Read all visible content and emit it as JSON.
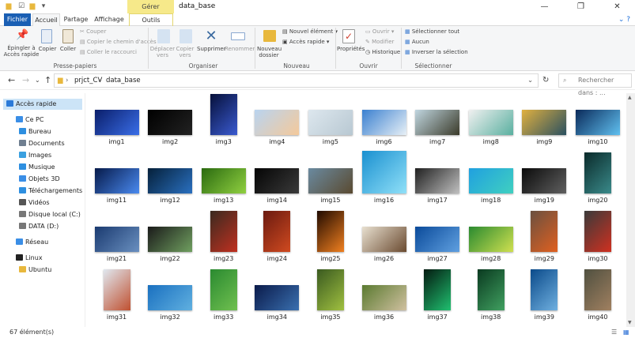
{
  "window": {
    "title": "data_base",
    "context_tab": "Gérer"
  },
  "tabs": [
    "Fichier",
    "Accueil",
    "Partage",
    "Affichage",
    "Outils d'image"
  ],
  "ribbon": {
    "presse_papiers": {
      "label": "Presse-papiers",
      "pin": "Épingler à\nAccès rapide",
      "copy": "Copier",
      "paste": "Coller",
      "cut": "Couper",
      "copy_path": "Copier le chemin d'accès",
      "paste_shortcut": "Coller le raccourci"
    },
    "organiser": {
      "label": "Organiser",
      "move": "Déplacer\nvers",
      "copy_to": "Copier\nvers",
      "delete": "Supprimer",
      "rename": "Renommer"
    },
    "nouveau": {
      "label": "Nouveau",
      "new_folder": "Nouveau\ndossier",
      "new_item": "Nouvel élément",
      "easy_access": "Accès rapide"
    },
    "ouvrir": {
      "label": "Ouvrir",
      "properties": "Propriétés",
      "open": "Ouvrir",
      "edit": "Modifier",
      "history": "Historique"
    },
    "selectionner": {
      "label": "Sélectionner",
      "select_all": "Sélectionner tout",
      "select_none": "Aucun",
      "invert": "Inverser la sélection"
    }
  },
  "address": {
    "parts": [
      "prjct_CV",
      "data_base"
    ],
    "search_placeholder": "Rechercher dans : ..."
  },
  "sidebar": [
    {
      "label": "Accès rapide",
      "icon": "star-icon",
      "color": "#2b7ad8",
      "selected": true
    },
    {
      "label": "Ce PC",
      "icon": "computer-icon",
      "color": "#3a8ee6"
    },
    {
      "label": "Bureau",
      "icon": "desktop-icon",
      "color": "#2e8fe0"
    },
    {
      "label": "Documents",
      "icon": "documents-icon",
      "color": "#6f7f90"
    },
    {
      "label": "Images",
      "icon": "images-icon",
      "color": "#3aa0e0"
    },
    {
      "label": "Musique",
      "icon": "music-icon",
      "color": "#2e8fe0"
    },
    {
      "label": "Objets 3D",
      "icon": "cube-icon",
      "color": "#3a8ee6"
    },
    {
      "label": "Téléchargements",
      "icon": "download-icon",
      "color": "#2e8fe0"
    },
    {
      "label": "Vidéos",
      "icon": "video-icon",
      "color": "#555"
    },
    {
      "label": "Disque local (C:)",
      "icon": "drive-icon",
      "color": "#777"
    },
    {
      "label": "DATA (D:)",
      "icon": "drive-icon",
      "color": "#777"
    },
    {
      "label": "Réseau",
      "icon": "network-icon",
      "color": "#3a8ee6"
    },
    {
      "label": "Linux",
      "icon": "linux-icon",
      "color": "#222"
    },
    {
      "label": "Ubuntu",
      "icon": "folder-icon",
      "color": "#e8b83d"
    }
  ],
  "files": [
    {
      "name": "img1",
      "c1": "#0a1e6a",
      "c2": "#3a6ee8",
      "o": "l"
    },
    {
      "name": "img2",
      "c1": "#000",
      "c2": "#222",
      "o": "l"
    },
    {
      "name": "img3",
      "c1": "#06103a",
      "c2": "#3a5ad0",
      "o": "p"
    },
    {
      "name": "img4",
      "c1": "#b9d4f0",
      "c2": "#f4c99a",
      "o": "l"
    },
    {
      "name": "img5",
      "c1": "#dde7ee",
      "c2": "#b8c8d2",
      "o": "l"
    },
    {
      "name": "img6",
      "c1": "#3a80d0",
      "c2": "#e8f0f6",
      "o": "l"
    },
    {
      "name": "img7",
      "c1": "#c0d6e0",
      "c2": "#3b3b2a",
      "o": "l"
    },
    {
      "name": "img8",
      "c1": "#f0f0f0",
      "c2": "#5ab0a0",
      "o": "l"
    },
    {
      "name": "img9",
      "c1": "#e0b040",
      "c2": "#2a5060",
      "o": "l"
    },
    {
      "name": "img10",
      "c1": "#0a2a5a",
      "c2": "#60c0f0",
      "o": "l"
    },
    {
      "name": "img11",
      "c1": "#061a4a",
      "c2": "#4a8af0",
      "o": "l"
    },
    {
      "name": "img12",
      "c1": "#05203a",
      "c2": "#2a70c0",
      "o": "l"
    },
    {
      "name": "img13",
      "c1": "#2a6a10",
      "c2": "#90d040",
      "o": "l"
    },
    {
      "name": "img14",
      "c1": "#050505",
      "c2": "#3a3a3a",
      "o": "l"
    },
    {
      "name": "img15",
      "c1": "#6a8aa0",
      "c2": "#5a4a30",
      "o": "l"
    },
    {
      "name": "img16",
      "c1": "#1a90d0",
      "c2": "#90e0f8",
      "o": "s"
    },
    {
      "name": "img17",
      "c1": "#202020",
      "c2": "#c0c0c0",
      "o": "l"
    },
    {
      "name": "img18",
      "c1": "#20a0e0",
      "c2": "#40d0c0",
      "o": "l"
    },
    {
      "name": "img19",
      "c1": "#0a0a0a",
      "c2": "#606060",
      "o": "l"
    },
    {
      "name": "img20",
      "c1": "#0a2a2a",
      "c2": "#3a8a8a",
      "o": "p"
    },
    {
      "name": "img21",
      "c1": "#1a3a70",
      "c2": "#6a90c0",
      "o": "l"
    },
    {
      "name": "img22",
      "c1": "#1a1a1a",
      "c2": "#70a060",
      "o": "l"
    },
    {
      "name": "img23",
      "c1": "#3a2a20",
      "c2": "#c03020",
      "o": "p"
    },
    {
      "name": "img24",
      "c1": "#6a1a10",
      "c2": "#d04a20",
      "o": "p"
    },
    {
      "name": "img25",
      "c1": "#200a00",
      "c2": "#f08020",
      "o": "p"
    },
    {
      "name": "img26",
      "c1": "#e8e0d0",
      "c2": "#6a4a30",
      "o": "l"
    },
    {
      "name": "img27",
      "c1": "#0a4a9a",
      "c2": "#60a0e0",
      "o": "l"
    },
    {
      "name": "img28",
      "c1": "#2a8a30",
      "c2": "#d0e050",
      "o": "l"
    },
    {
      "name": "img29",
      "c1": "#6a5040",
      "c2": "#e06020",
      "o": "p"
    },
    {
      "name": "img30",
      "c1": "#3a3a3a",
      "c2": "#d03020",
      "o": "p"
    },
    {
      "name": "img31",
      "c1": "#e0e8f0",
      "c2": "#c05030",
      "o": "p"
    },
    {
      "name": "img32",
      "c1": "#1a70c0",
      "c2": "#60b0e0",
      "o": "l"
    },
    {
      "name": "img33",
      "c1": "#2a8a30",
      "c2": "#70c050",
      "o": "p"
    },
    {
      "name": "img34",
      "c1": "#0a1a4a",
      "c2": "#3a70b0",
      "o": "l"
    },
    {
      "name": "img35",
      "c1": "#3a5a20",
      "c2": "#a0c040",
      "o": "p"
    },
    {
      "name": "img36",
      "c1": "#5a7a30",
      "c2": "#d0c0a0",
      "o": "l"
    },
    {
      "name": "img37",
      "c1": "#041a10",
      "c2": "#20c070",
      "o": "p"
    },
    {
      "name": "img38",
      "c1": "#0a3a20",
      "c2": "#40a060",
      "o": "p"
    },
    {
      "name": "img39",
      "c1": "#0a4a8a",
      "c2": "#70b0e0",
      "o": "p"
    },
    {
      "name": "img40",
      "c1": "#505040",
      "c2": "#a08060",
      "o": "p"
    }
  ],
  "status": {
    "count": "67 élément(s)"
  }
}
